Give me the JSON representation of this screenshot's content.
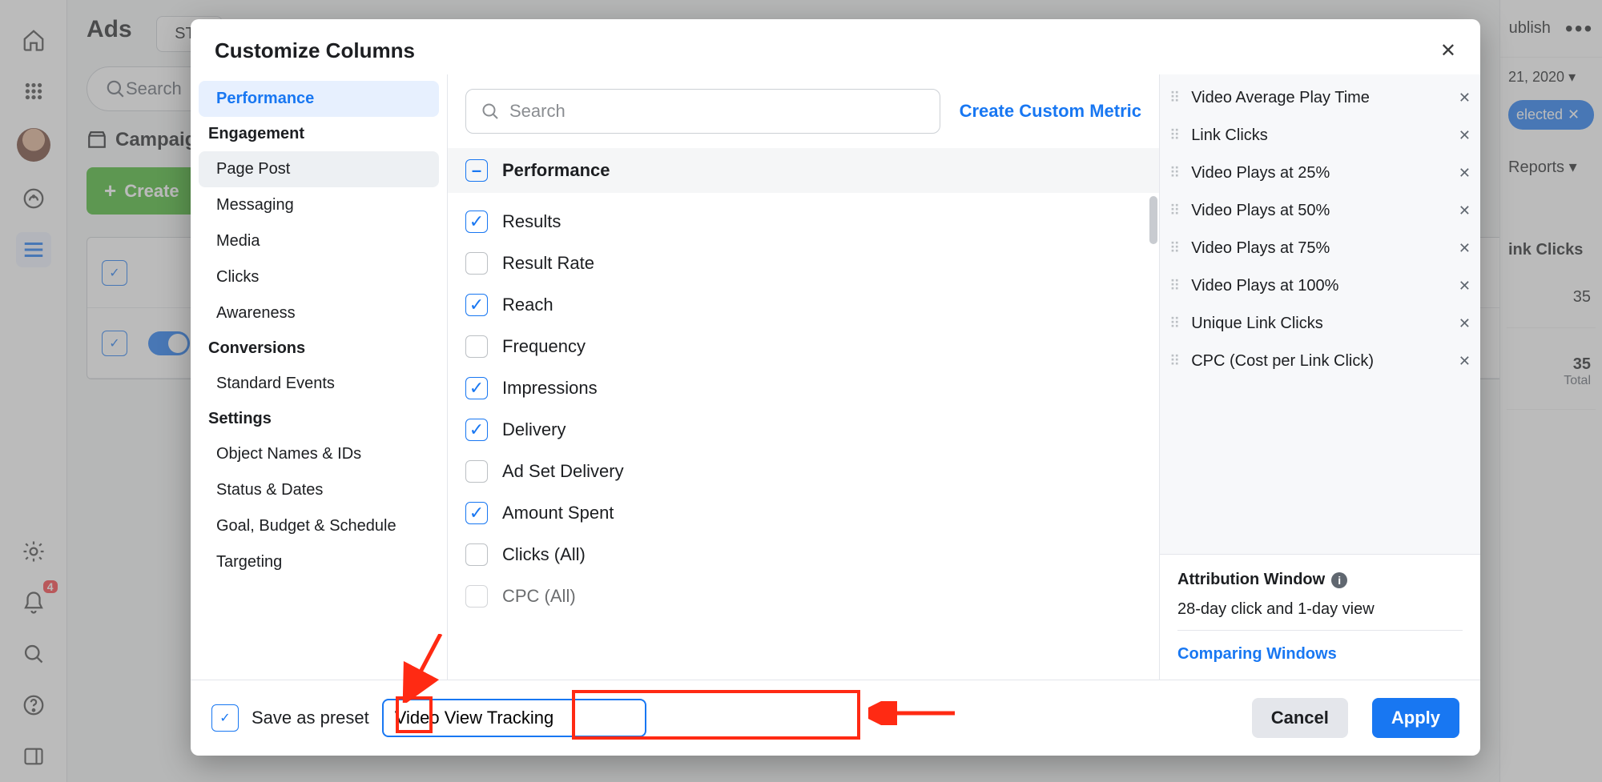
{
  "page": {
    "title": "Ads",
    "account_prefix": "STL",
    "search_placeholder": "Search",
    "campaigns_tab": "Campaigns",
    "create_label": "Create",
    "publish": "ublish",
    "selected_pill": "elected",
    "date": "21, 2020",
    "reports": "Reports",
    "col_link_clicks": "ink Clicks",
    "cell1": "35",
    "cell2": "35",
    "cell2_sub": "Total",
    "bell_badge": "4"
  },
  "modal": {
    "title": "Customize Columns",
    "search_placeholder": "Search",
    "create_metric": "Create Custom Metric",
    "perf_group": "Performance",
    "save_as_preset": "Save as preset",
    "preset_name": "Video View Tracking",
    "cancel": "Cancel",
    "apply": "Apply"
  },
  "categories": [
    {
      "type": "item",
      "label": "Performance",
      "state": "on"
    },
    {
      "type": "group",
      "label": "Engagement"
    },
    {
      "type": "item",
      "label": "Page Post",
      "state": "sel2"
    },
    {
      "type": "item",
      "label": "Messaging"
    },
    {
      "type": "item",
      "label": "Media"
    },
    {
      "type": "item",
      "label": "Clicks"
    },
    {
      "type": "item",
      "label": "Awareness"
    },
    {
      "type": "group",
      "label": "Conversions"
    },
    {
      "type": "item",
      "label": "Standard Events"
    },
    {
      "type": "group",
      "label": "Settings"
    },
    {
      "type": "item",
      "label": "Object Names & IDs"
    },
    {
      "type": "item",
      "label": "Status & Dates"
    },
    {
      "type": "item",
      "label": "Goal, Budget & Schedule"
    },
    {
      "type": "item",
      "label": "Targeting"
    }
  ],
  "metrics": [
    {
      "label": "Results",
      "checked": true
    },
    {
      "label": "Result Rate",
      "checked": false
    },
    {
      "label": "Reach",
      "checked": true
    },
    {
      "label": "Frequency",
      "checked": false
    },
    {
      "label": "Impressions",
      "checked": true
    },
    {
      "label": "Delivery",
      "checked": true
    },
    {
      "label": "Ad Set Delivery",
      "checked": false
    },
    {
      "label": "Amount Spent",
      "checked": true
    },
    {
      "label": "Clicks (All)",
      "checked": false
    }
  ],
  "metrics_cut": "CPC (All)",
  "selected_columns": [
    "Video Average Play Time",
    "Link Clicks",
    "Video Plays at 25%",
    "Video Plays at 50%",
    "Video Plays at 75%",
    "Video Plays at 100%",
    "Unique Link Clicks",
    "CPC (Cost per Link Click)"
  ],
  "attribution": {
    "title": "Attribution Window",
    "value": "28-day click and 1-day view",
    "compare": "Comparing Windows"
  }
}
